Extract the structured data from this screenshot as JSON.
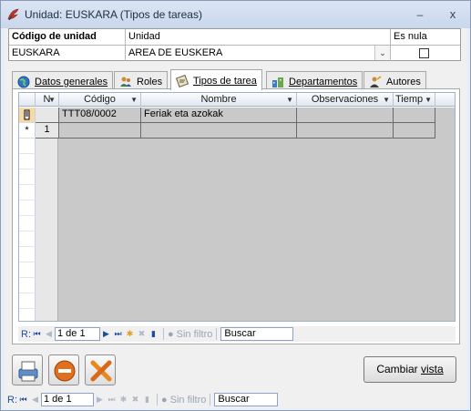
{
  "window": {
    "title": "Unidad: EUSKARA (Tipos de tareas)",
    "minimize_glyph": "–",
    "close_glyph": "x"
  },
  "header": {
    "code_label": "Código de unidad",
    "unit_label": "Unidad",
    "null_label": "Es nula",
    "code_value": "EUSKARA",
    "unit_value": "AREA DE EUSKERA",
    "is_null": false
  },
  "tabs": [
    {
      "label": "Datos generales",
      "icon": "globe-icon",
      "active": false
    },
    {
      "label": "Roles",
      "icon": "users-icon",
      "active": false
    },
    {
      "label": "Tipos de tarea",
      "icon": "tasks-icon",
      "active": true
    },
    {
      "label": "Departamentos",
      "icon": "departments-icon",
      "active": false
    },
    {
      "label": "Autores",
      "icon": "author-icon",
      "active": false
    }
  ],
  "grid": {
    "columns": [
      "N",
      "Código",
      "Nombre",
      "Observaciones",
      "Tiemp"
    ],
    "rows": [
      {
        "marker": "edit",
        "n": "",
        "codigo": "TTT08/0002",
        "nombre": "Feriak eta azokak",
        "observaciones": "",
        "tiempo": ""
      },
      {
        "marker": "*",
        "n": "1",
        "codigo": "",
        "nombre": "",
        "observaciones": "",
        "tiempo": ""
      }
    ]
  },
  "grid_nav": {
    "record_label": "R:",
    "position": "1 de 1",
    "filter_label": "Sin filtro",
    "search_placeholder": "Buscar"
  },
  "form_nav": {
    "record_label": "R:",
    "position": "1 de 1",
    "filter_label": "Sin filtro",
    "search_placeholder": "Buscar"
  },
  "buttons": {
    "print": "print-icon",
    "cancel": "cancel-icon",
    "tools": "tools-icon",
    "change_view_prefix": "Cambiar ",
    "change_view_underlined": "vista"
  }
}
